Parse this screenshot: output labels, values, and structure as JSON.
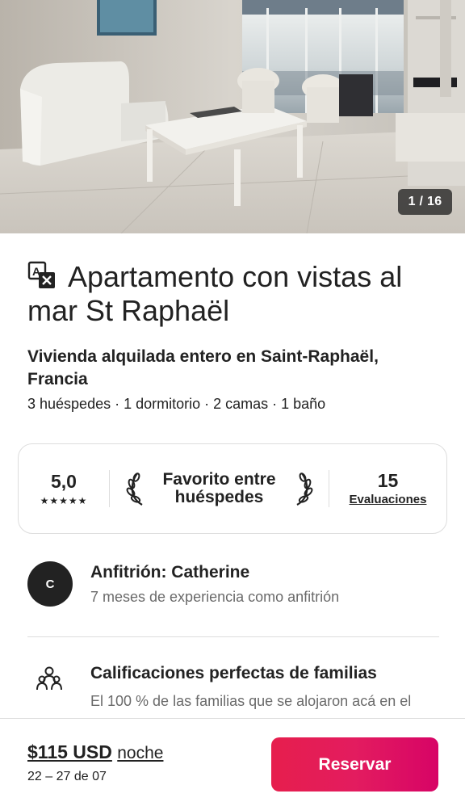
{
  "hero": {
    "counter": "1 / 16"
  },
  "listing": {
    "title": "Apartamento con vistas al mar St Raphaël",
    "subtitle": "Vivienda alquilada entero en Saint-Raphaël, Francia",
    "details": "3 huéspedes · 1 dormitorio · 2 camas · 1 baño"
  },
  "rating_card": {
    "score": "5,0",
    "stars": "★★★★★",
    "star_count": 5,
    "favorite_label": "Favorito entre huéspedes",
    "reviews_count": "15",
    "reviews_link": "Evaluaciones"
  },
  "host": {
    "initial": "C",
    "name": "Anfitrión: Catherine",
    "experience": "7 meses de experiencia como anfitrión"
  },
  "highlight": {
    "title": "Calificaciones perfectas de familias",
    "description": "El 100 % de las familias que se alojaron acá en el"
  },
  "footer": {
    "price": "$115 USD",
    "price_unit": "noche",
    "dates": "22 – 27 de 07",
    "reserve_label": "Reservar"
  },
  "colors": {
    "brand": "#e31c5f",
    "text": "#222222",
    "muted": "#6a6a6a",
    "border": "#dddddd"
  },
  "icons": {
    "translate": "translate-icon",
    "laurel": "laurel-icon",
    "family": "family-icon"
  }
}
